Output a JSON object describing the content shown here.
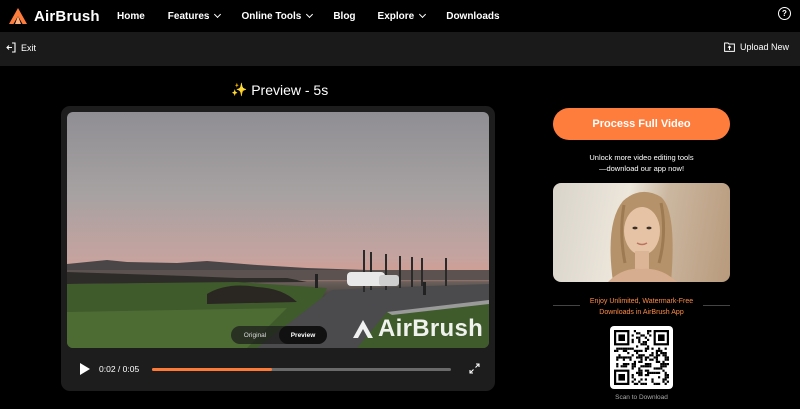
{
  "brand": {
    "name": "AirBrush",
    "accent": "#ff7d3c"
  },
  "nav": {
    "items": [
      {
        "label": "Home",
        "dropdown": false
      },
      {
        "label": "Features",
        "dropdown": true
      },
      {
        "label": "Online Tools",
        "dropdown": true
      },
      {
        "label": "Blog",
        "dropdown": false
      },
      {
        "label": "Explore",
        "dropdown": true
      },
      {
        "label": "Downloads",
        "dropdown": false
      }
    ],
    "help_icon": "question-circle-icon",
    "help_glyph": "?"
  },
  "subbar": {
    "exit_label": "Exit",
    "upload_label": "Upload New"
  },
  "preview": {
    "title": "Preview - 5s",
    "title_icon": "sparkle-icon"
  },
  "player": {
    "toggle": {
      "original": "Original",
      "preview": "Preview",
      "selected": "Preview"
    },
    "watermark": "AirBrush",
    "time": "0:02 / 0:05",
    "progress": 0.4
  },
  "sidebar": {
    "cta_label": "Process Full Video",
    "unlock_line1": "Unlock more video editing tools",
    "unlock_line2": "—download our app now!",
    "enjoy_line1": "Enjoy Unlimited, Watermark-Free",
    "enjoy_line2": "Downloads in  AirBrush App",
    "scan_label": "Scan to Download"
  }
}
